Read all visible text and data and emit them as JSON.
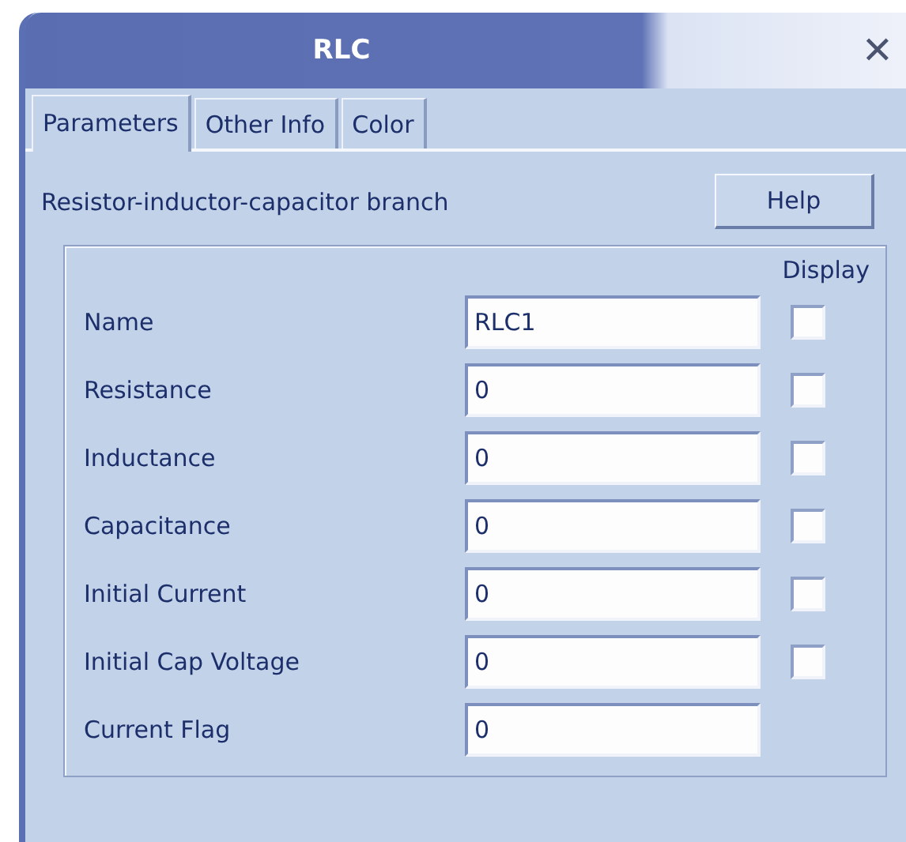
{
  "window": {
    "title": "RLC",
    "close": "✕"
  },
  "tabs": [
    {
      "label": "Parameters",
      "selected": true
    },
    {
      "label": "Other Info",
      "selected": false
    },
    {
      "label": "Color",
      "selected": false
    }
  ],
  "description": "Resistor-inductor-capacitor branch",
  "help_button": "Help",
  "display_header": "Display",
  "rows": [
    {
      "kind": "checkbox",
      "label": "Name",
      "value": "RLC1",
      "checked": false
    },
    {
      "kind": "checkbox",
      "label": "Resistance",
      "value": "0",
      "checked": false
    },
    {
      "kind": "checkbox",
      "label": "Inductance",
      "value": "0",
      "checked": false
    },
    {
      "kind": "checkbox",
      "label": "Capacitance",
      "value": "0",
      "checked": false
    },
    {
      "kind": "checkbox",
      "label": "Initial Current",
      "value": "0",
      "checked": false
    },
    {
      "kind": "checkbox",
      "label": "Initial Cap Voltage",
      "value": "0",
      "checked": false
    },
    {
      "kind": "plain",
      "label": "Current Flag",
      "value": "0"
    }
  ]
}
